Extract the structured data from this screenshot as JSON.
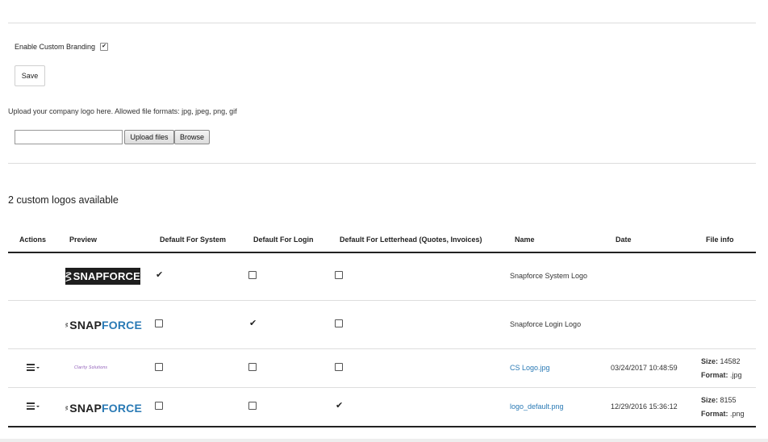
{
  "branding": {
    "enable_label": "Enable Custom Branding",
    "enabled": true,
    "save_label": "Save"
  },
  "upload": {
    "hint": "Upload your company logo here. Allowed file formats: jpg, jpeg, png, gif",
    "file_value": "",
    "upload_label": "Upload files",
    "browse_label": "Browse"
  },
  "logos": {
    "count_text": "2 custom logos available",
    "headers": {
      "actions": "Actions",
      "preview": "Preview",
      "default_system": "Default For System",
      "default_login": "Default For Login",
      "default_letterhead": "Default For Letterhead (Quotes, Invoices)",
      "name": "Name",
      "date": "Date",
      "file_info": "File info"
    },
    "size_label": "Size:",
    "format_label": "Format:",
    "rows": [
      {
        "name": "Snapforce System Logo",
        "date": "",
        "size": "",
        "format": "",
        "default_system": true,
        "default_login": false,
        "default_letterhead": false,
        "logo_text_a": "SNAP",
        "logo_text_b": "FORCE"
      },
      {
        "name": "Snapforce Login Logo",
        "date": "",
        "size": "",
        "format": "",
        "default_system": false,
        "default_login": true,
        "default_letterhead": false,
        "logo_text_a": "SNAP",
        "logo_text_b": "FORCE"
      },
      {
        "name": "CS Logo.jpg",
        "date": "03/24/2017 10:48:59",
        "size": "14582",
        "format": ".jpg",
        "default_system": false,
        "default_login": false,
        "default_letterhead": false,
        "logo_text_a": "Clarity Solutions",
        "logo_text_b": ""
      },
      {
        "name": "logo_default.png",
        "date": "12/29/2016 15:36:12",
        "size": "8155",
        "format": ".png",
        "default_system": false,
        "default_login": false,
        "default_letterhead": true,
        "logo_text_a": "SNAP",
        "logo_text_b": "FORCE"
      }
    ]
  },
  "icons": {
    "check_glyph": "✔",
    "menu": "menu-icon"
  },
  "colors": {
    "link": "#2a7ab5",
    "logo_dark_bg": "#1e1e1e",
    "clarity_purple": "#8a55b5"
  }
}
